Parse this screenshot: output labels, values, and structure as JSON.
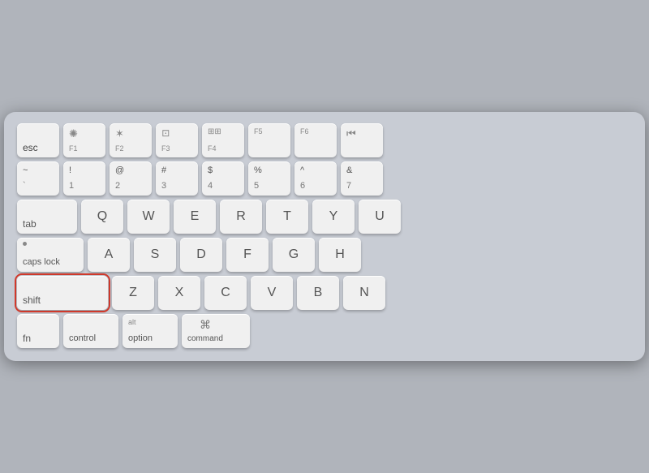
{
  "keyboard": {
    "background": "#c8ccd4",
    "rows": {
      "fn_row": {
        "keys": [
          {
            "id": "esc",
            "label": "esc",
            "width": "esc"
          },
          {
            "id": "f1",
            "top": "☼",
            "label": "F1",
            "width": "fn"
          },
          {
            "id": "f2",
            "top": "☼",
            "label": "F2",
            "width": "fn"
          },
          {
            "id": "f3",
            "top": "⊞",
            "label": "F3",
            "width": "fn"
          },
          {
            "id": "f4",
            "top": "⊞⊞",
            "label": "F4",
            "width": "fn"
          },
          {
            "id": "f5",
            "label": "F5",
            "width": "fn"
          },
          {
            "id": "f6",
            "label": "F6",
            "width": "fn"
          },
          {
            "id": "f7",
            "top": "⏮",
            "label": "",
            "width": "fn"
          }
        ]
      },
      "number_row": {
        "keys": [
          {
            "id": "tilde",
            "top": "~",
            "bottom": "`"
          },
          {
            "id": "1",
            "top": "!",
            "bottom": "1"
          },
          {
            "id": "2",
            "top": "@",
            "bottom": "2"
          },
          {
            "id": "3",
            "top": "#",
            "bottom": "3"
          },
          {
            "id": "4",
            "top": "$",
            "bottom": "4"
          },
          {
            "id": "5",
            "top": "%",
            "bottom": "5"
          },
          {
            "id": "6",
            "top": "^",
            "bottom": "6"
          },
          {
            "id": "7",
            "top": "&",
            "bottom": "7"
          }
        ]
      },
      "qwerty_row": {
        "keys": [
          "Q",
          "W",
          "E",
          "R",
          "T",
          "Y",
          "U"
        ]
      },
      "asdf_row": {
        "keys": [
          "A",
          "S",
          "D",
          "F",
          "G",
          "H"
        ]
      },
      "zxcv_row": {
        "keys": [
          "Z",
          "X",
          "C",
          "V",
          "B",
          "N"
        ]
      },
      "bottom_row": {
        "fn_label": "fn",
        "ctrl_label": "control",
        "alt_label": "alt",
        "option_label": "option",
        "cmd_symbol": "⌘",
        "cmd_label": "command"
      }
    },
    "highlighted_key": "shift",
    "shift_label": "shift"
  }
}
